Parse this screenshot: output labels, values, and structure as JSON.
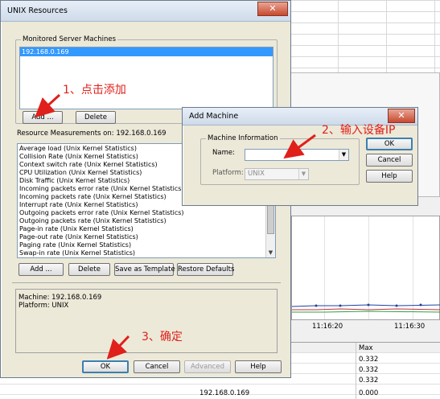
{
  "background": {
    "graph_ticks": [
      "11:16:20",
      "11:16:30"
    ],
    "table_header": "Max",
    "table_values": [
      "0.332",
      "0.332",
      "0.332",
      "0.000"
    ],
    "footer_machine": "192.168.0.169"
  },
  "unix_dialog": {
    "title": "UNIX Resources",
    "monitored_group_label": "Monitored Server Machines",
    "machines": [
      "192.168.0.169"
    ],
    "add_label": "Add ...",
    "delete_label": "Delete",
    "resource_label": "Resource Measurements on: 192.168.0.169",
    "measurements": [
      "Average load (Unix Kernel Statistics)",
      "Collision Rate (Unix Kernel Statistics)",
      "Context switch rate (Unix Kernel Statistics)",
      "CPU Utilization (Unix Kernel Statistics)",
      "Disk Traffic (Unix Kernel Statistics)",
      "Incoming packets error rate (Unix Kernel Statistics)",
      "Incoming packets rate (Unix Kernel Statistics)",
      "Interrupt rate (Unix Kernel Statistics)",
      "Outgoing packets error rate (Unix Kernel Statistics)",
      "Outgoing packets rate (Unix Kernel Statistics)",
      "Page-in rate (Unix Kernel Statistics)",
      "Page-out rate (Unix Kernel Statistics)",
      "Paging rate (Unix Kernel Statistics)",
      "Swap-in rate (Unix Kernel Statistics)"
    ],
    "add2_label": "Add ...",
    "delete2_label": "Delete",
    "save_template_label": "Save as Template",
    "restore_defaults_label": "Restore Defaults",
    "description_machine": "Machine: 192.168.0.169",
    "description_platform": "Platform: UNIX",
    "ok_label": "OK",
    "cancel_label": "Cancel",
    "advanced_label": "Advanced",
    "help_label": "Help"
  },
  "add_machine_dialog": {
    "title": "Add Machine",
    "group_label": "Machine Information",
    "name_label": "Name:",
    "name_value": "",
    "platform_label": "Platform:",
    "platform_value": "UNIX",
    "ok_label": "OK",
    "cancel_label": "Cancel",
    "help_label": "Help"
  },
  "annotations": {
    "step1": "1、点击添加",
    "step2": "2、输入设备IP",
    "step3": "3、确定"
  },
  "colors": {
    "annotation": "#e0201b",
    "selection": "#3399ff",
    "dialog_face": "#ece9d8"
  }
}
